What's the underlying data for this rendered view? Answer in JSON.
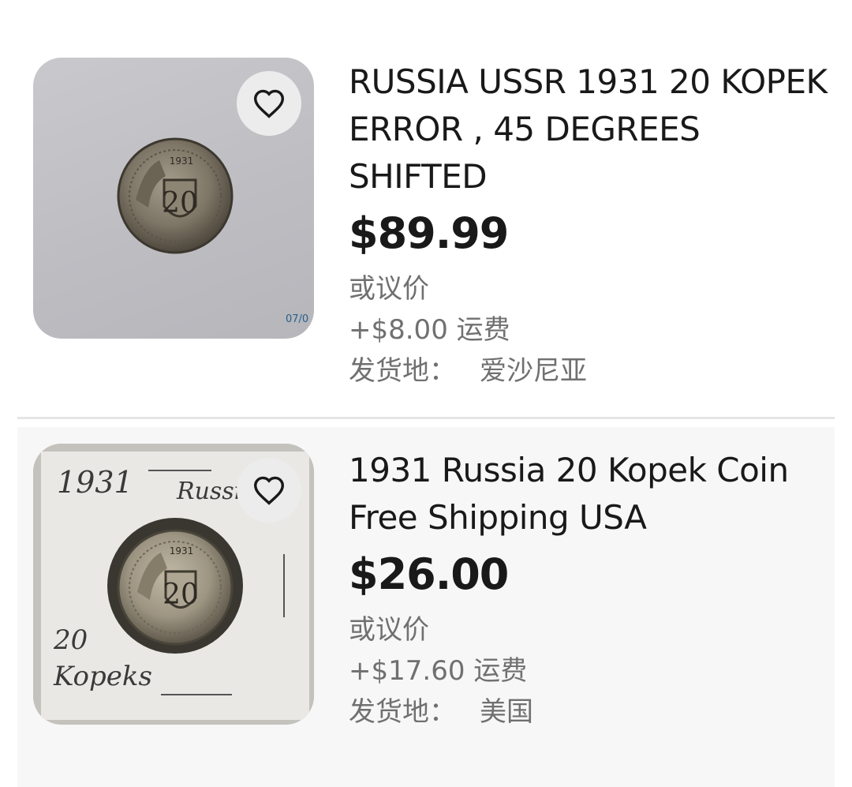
{
  "listings": [
    {
      "title": "RUSSIA USSR 1931 20 KOPEK ERROR , 45 DEGREES SHIFTED",
      "price": "$89.99",
      "offer": "或议价",
      "shipping": "+$8.00 运费",
      "location_label": "发货地：",
      "location": "爱沙尼亚",
      "image_date_stamp": "07/0"
    },
    {
      "title": "1931 Russia 20 Kopek Coin Free Shipping USA",
      "price": "$26.00",
      "offer": "或议价",
      "shipping": "+$17.60 运费",
      "location_label": "发货地：",
      "location": "美国",
      "holder_text_year": "1931",
      "holder_text_country": "Russia",
      "holder_text_denom_1": "20",
      "holder_text_denom_2": "Kopeks"
    }
  ],
  "icons": {
    "favorite": "heart-outline-icon"
  },
  "colors": {
    "text_primary": "#191919",
    "text_secondary": "#707070",
    "fav_bg": "#ececec",
    "card_alt_bg": "#f7f7f7"
  }
}
